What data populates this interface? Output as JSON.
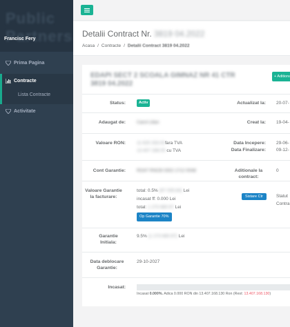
{
  "sidebar": {
    "logo": "Public Partners",
    "user": "Francisc Fery",
    "items": [
      {
        "label": "Prima Pagina",
        "icon": "diamond-icon"
      },
      {
        "label": "Contracte",
        "icon": "bar-chart-icon"
      },
      {
        "label": "Activitate",
        "icon": "diamond-icon"
      }
    ],
    "subitem": "Lista Contracte"
  },
  "topbar": {
    "menu_icon": "hamburger-icon",
    "accent": "#1ab394"
  },
  "heading": {
    "title": "Detalii Contract Nr.",
    "title_blur": "3819 04.2022",
    "breadcrumb": [
      "Acasa",
      "Contracte",
      "Detalii Contract 3819 04.2022"
    ]
  },
  "panel": {
    "title_blur": "EDAPI SECT 2 SCOALA GIMNAZ NR 41 CTR 3819 04.2022",
    "add_button": "+ Aditional",
    "status_label": "Status:",
    "status_value": "Activ",
    "adaugat_label": "Adaugat de:",
    "adaugat_value": "Carol Lilian",
    "valoare_label": "Valoare RON:",
    "valoare_ron_fara": "11 625 333.00",
    "valoare_ron_fara_suffix": "fara TVA",
    "valoare_ron_cu": "13 407 168.00",
    "valoare_ron_cu_suffix": "cu TVA",
    "cont_label": "Cont Garantie:",
    "cont_value": "RO47 RNCB 0302 1712 0048",
    "garantie_facturare_label": "Valoare Garantie la facturare:",
    "gf_total_pct": "total: 0.5%",
    "gf_total_pct_blur": "(67 035.84)",
    "gf_total_pct_suffix": "Lei",
    "gf_incasat": "incasat ff: 0.000 Lei",
    "gf_total": "total:",
    "gf_total_blur": "1 273 680.97",
    "gf_total_suffix": "Lei",
    "gf_button": "Op Garantie 70%",
    "garantie_initiala_label": "Garantie Initiala:",
    "gi_value": "9.5%",
    "gi_blur": "(1 273 680.97)",
    "gi_suffix": "Lei",
    "deblocare_label": "Data deblocare Garantie:",
    "deblocare_value": "29-10-2027",
    "incasat_label": "Incasat:",
    "incasat_progress": 0.0,
    "incasat_text_pre": "Incasat",
    "incasat_pct": "0.000%.",
    "incasat_text_mid": "Adica 0.000 RON din 13.407.168.130 Ron (Rest:",
    "incasat_rest": "13.407.168.130",
    "incasat_text_post": ")",
    "actualizat_label": "Actualizat la:",
    "actualizat_value": "20-07-",
    "creat_label": "Creat la:",
    "creat_value": "19-04-",
    "data_incepere_label": "Data Incepere:",
    "data_incepere_value": "29-06-",
    "data_finalizare_label": "Data Finalizare:",
    "data_finalizare_value": "09-12-",
    "aditionale_label": "Aditionale la contract:",
    "aditionale_value": "0",
    "sistare_button": "Sistare Ctr",
    "statut_text": "Statut",
    "statut_sub": "Contra"
  }
}
